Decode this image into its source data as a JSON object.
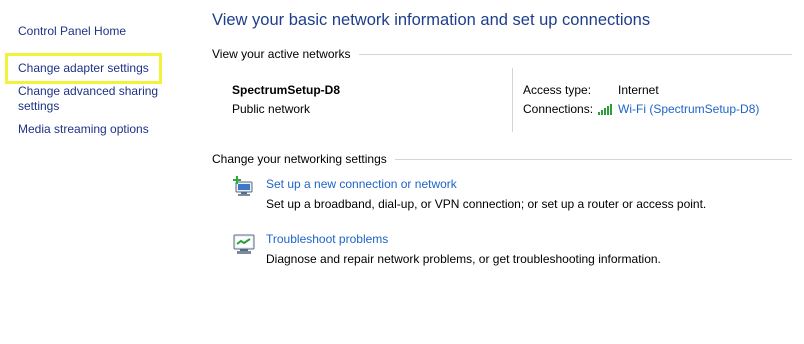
{
  "sidebar": {
    "items": [
      {
        "label": "Control Panel Home"
      },
      {
        "label": "Change adapter settings"
      },
      {
        "label": "Change advanced sharing settings"
      },
      {
        "label": "Media streaming options"
      }
    ]
  },
  "main": {
    "title": "View your basic network information and set up connections",
    "active_networks": {
      "header": "View your active networks",
      "network_name": "SpectrumSetup-D8",
      "network_category": "Public network",
      "access_type_label": "Access type:",
      "access_type_value": "Internet",
      "connections_label": "Connections:",
      "connections_value": "Wi-Fi (SpectrumSetup-D8)"
    },
    "change_settings": {
      "header": "Change your networking settings",
      "tasks": [
        {
          "link": "Set up a new connection or network",
          "description": "Set up a broadband, dial-up, or VPN connection; or set up a router or access point.",
          "icon": "new-connection-icon"
        },
        {
          "link": "Troubleshoot problems",
          "description": "Diagnose and repair network problems, or get troubleshooting information.",
          "icon": "troubleshoot-icon"
        }
      ]
    }
  },
  "colors": {
    "title": "#1e3e8c",
    "link": "#1e64c8",
    "sidebar_link": "#1e3287",
    "highlight": "#f2f23a",
    "signal": "#2e9e3a"
  }
}
